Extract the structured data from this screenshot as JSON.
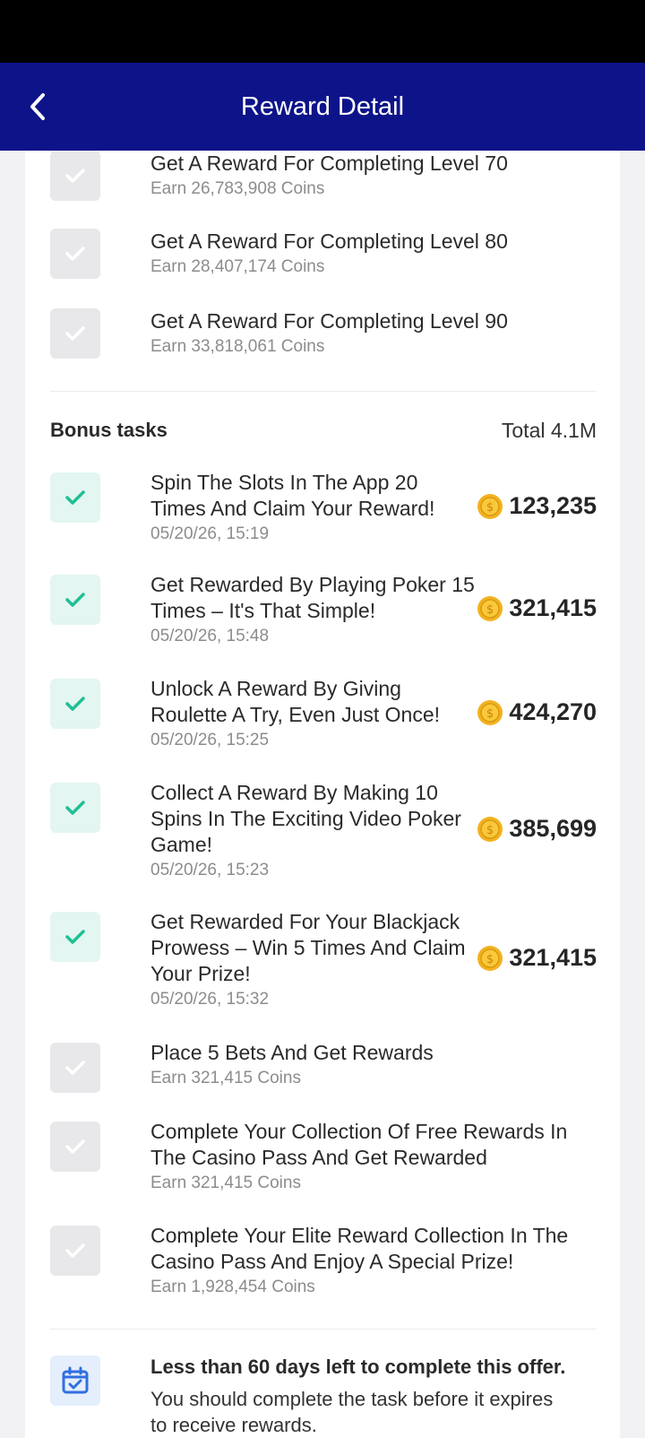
{
  "header": {
    "title": "Reward Detail"
  },
  "level_tasks": [
    {
      "title": "Get A Reward For Completing Level 70",
      "sub": "Earn 26,783,908 Coins"
    },
    {
      "title": "Get A Reward For Completing Level 80",
      "sub": "Earn 28,407,174 Coins"
    },
    {
      "title": "Get A Reward For Completing Level 90",
      "sub": "Earn 33,818,061 Coins"
    }
  ],
  "bonus": {
    "label": "Bonus tasks",
    "total": "Total 4.1M",
    "done": [
      {
        "line1": "Spin The Slots In The App 20",
        "line2": "Times And Claim Your Reward!",
        "line3": "",
        "date": "05/20/26, 15:19",
        "amount": "123,235"
      },
      {
        "line1": "Get Rewarded By Playing Poker 15",
        "line2": "Times – It's That Simple!",
        "line3": "",
        "date": "05/20/26, 15:48",
        "amount": "321,415"
      },
      {
        "line1": "Unlock A Reward By Giving",
        "line2": "Roulette A Try, Even Just Once!",
        "line3": "",
        "date": "05/20/26, 15:25",
        "amount": "424,270"
      },
      {
        "line1": "Collect A Reward By Making 10",
        "line2": "Spins In The Exciting Video Poker",
        "line3": "Game!",
        "date": "05/20/26, 15:23",
        "amount": "385,699"
      },
      {
        "line1": "Get Rewarded For Your Blackjack",
        "line2": "Prowess – Win 5 Times And Claim",
        "line3": "Your Prize!",
        "date": "05/20/26, 15:32",
        "amount": "321,415"
      }
    ],
    "pending": [
      {
        "line1": "Place 5 Bets And Get Rewards",
        "line2": "",
        "sub": "Earn 321,415 Coins"
      },
      {
        "line1": "Complete Your Collection Of Free Rewards In",
        "line2": "The Casino Pass And Get Rewarded",
        "sub": "Earn 321,415 Coins"
      },
      {
        "line1": "Complete Your Elite Reward Collection In The",
        "line2": "Casino Pass And Enjoy A Special Prize!",
        "sub": "Earn 1,928,454 Coins"
      }
    ]
  },
  "notice": {
    "title": "Less than 60 days left to complete this offer.",
    "line1": "You should complete the task before it expires",
    "line2": "to receive rewards."
  },
  "colors": {
    "header_bg": "#0d1489",
    "check_done": "#1fbf95",
    "check_pending": "#ffffff",
    "coin": "#f3b21f",
    "calendar": "#2f6fe0"
  }
}
